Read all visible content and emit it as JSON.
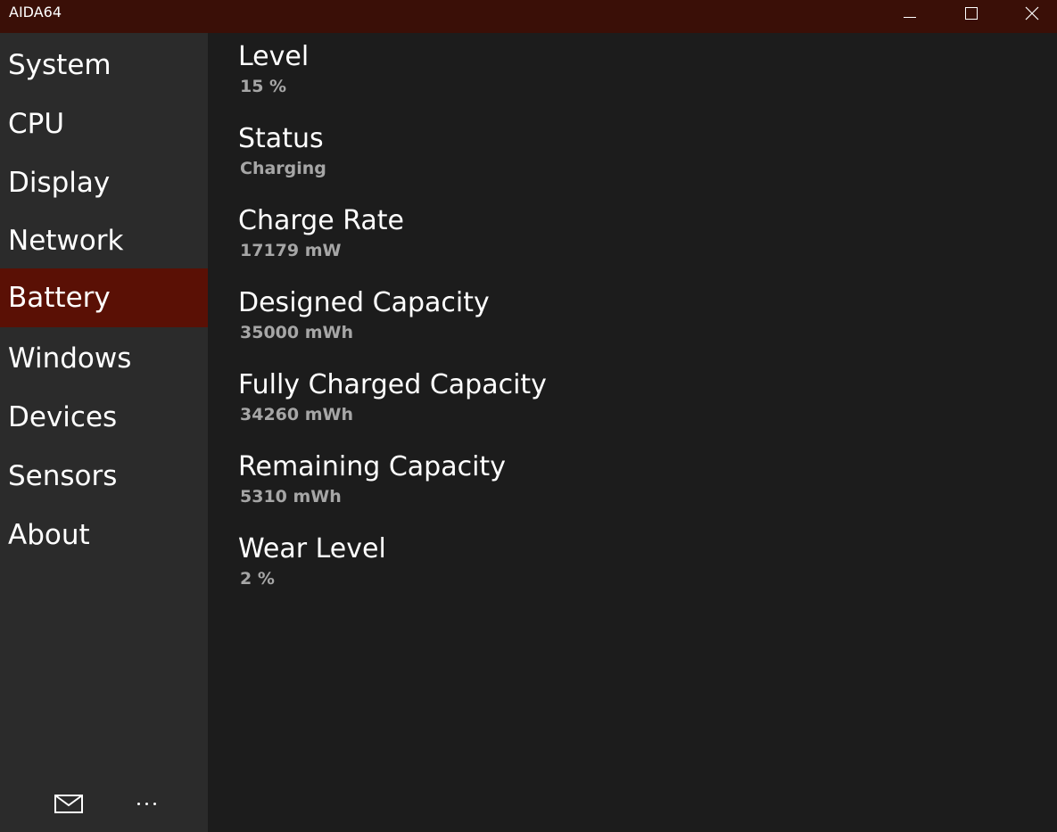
{
  "window": {
    "title": "AIDA64",
    "title_bar_color": "#3a0f07",
    "accent_color": "#5a1005"
  },
  "sidebar": {
    "items": [
      {
        "label": "System",
        "active": false
      },
      {
        "label": "CPU",
        "active": false
      },
      {
        "label": "Display",
        "active": false
      },
      {
        "label": "Network",
        "active": false
      },
      {
        "label": "Battery",
        "active": true
      },
      {
        "label": "Windows",
        "active": false
      },
      {
        "label": "Devices",
        "active": false
      },
      {
        "label": "Sensors",
        "active": false
      },
      {
        "label": "About",
        "active": false
      }
    ],
    "footer_icons": [
      "mail-icon",
      "more-icon"
    ]
  },
  "battery": {
    "properties": [
      {
        "name": "Level",
        "value": "15 %"
      },
      {
        "name": "Status",
        "value": "Charging"
      },
      {
        "name": "Charge Rate",
        "value": "17179 mW"
      },
      {
        "name": "Designed Capacity",
        "value": "35000 mWh"
      },
      {
        "name": "Fully Charged Capacity",
        "value": "34260 mWh"
      },
      {
        "name": "Remaining Capacity",
        "value": "5310 mWh"
      },
      {
        "name": "Wear Level",
        "value": "2 %"
      }
    ]
  }
}
